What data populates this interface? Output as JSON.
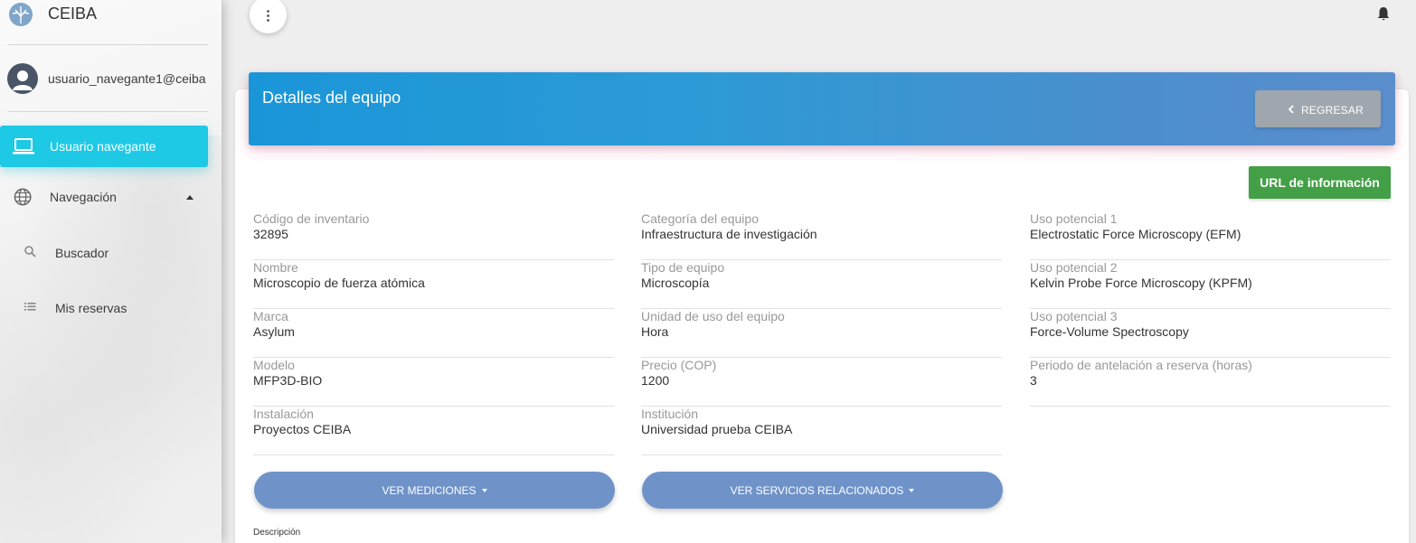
{
  "brand": {
    "name": "CEIBA"
  },
  "user": {
    "email": "usuario_navegante1@ceiba"
  },
  "sidebar": {
    "items": [
      {
        "label": "Usuario navegante",
        "icon": "laptop-icon",
        "active": true
      },
      {
        "label": "Navegación",
        "icon": "globe-icon",
        "expanded": true
      }
    ],
    "subitems": [
      {
        "label": "Buscador",
        "icon": "search-icon"
      },
      {
        "label": "Mis reservas",
        "icon": "list-icon"
      }
    ]
  },
  "card": {
    "title": "Detalles del equipo",
    "back_label": "REGRESAR",
    "url_label": "URL de información",
    "fields": {
      "col1": [
        {
          "label": "Código de inventario",
          "value": "32895"
        },
        {
          "label": "Nombre",
          "value": "Microscopio de fuerza atómica"
        },
        {
          "label": "Marca",
          "value": "Asylum"
        },
        {
          "label": "Modelo",
          "value": "MFP3D-BIO"
        },
        {
          "label": "Instalación",
          "value": "Proyectos CEIBA"
        }
      ],
      "col2": [
        {
          "label": "Categoría del equipo",
          "value": "Infraestructura de investigación"
        },
        {
          "label": "Tipo de equipo",
          "value": "Microscopía"
        },
        {
          "label": "Unidad de uso del equipo",
          "value": "Hora"
        },
        {
          "label": "Precio (COP)",
          "value": "1200"
        },
        {
          "label": "Institución",
          "value": "Universidad prueba CEIBA"
        }
      ],
      "col3": [
        {
          "label": "Uso potencial 1",
          "value": "Electrostatic Force Microscopy (EFM)"
        },
        {
          "label": "Uso potencial 2",
          "value": "Kelvin Probe Force Microscopy (KPFM)"
        },
        {
          "label": "Uso potencial 3",
          "value": "Force-Volume Spectroscopy"
        },
        {
          "label": "Periodo de antelación a reserva (horas)",
          "value": "3"
        }
      ]
    },
    "mediciones_label": "VER MEDICIONES",
    "servicios_label": "VER SERVICIOS RELACIONADOS",
    "description_label": "Descripción"
  },
  "colors": {
    "active_nav": "#1ec9e6",
    "header_start": "#1a96d8",
    "header_end": "#5b8ecd",
    "url_button": "#43a047",
    "pill_button": "#6f93c9",
    "back_button": "#a0a6ad"
  }
}
